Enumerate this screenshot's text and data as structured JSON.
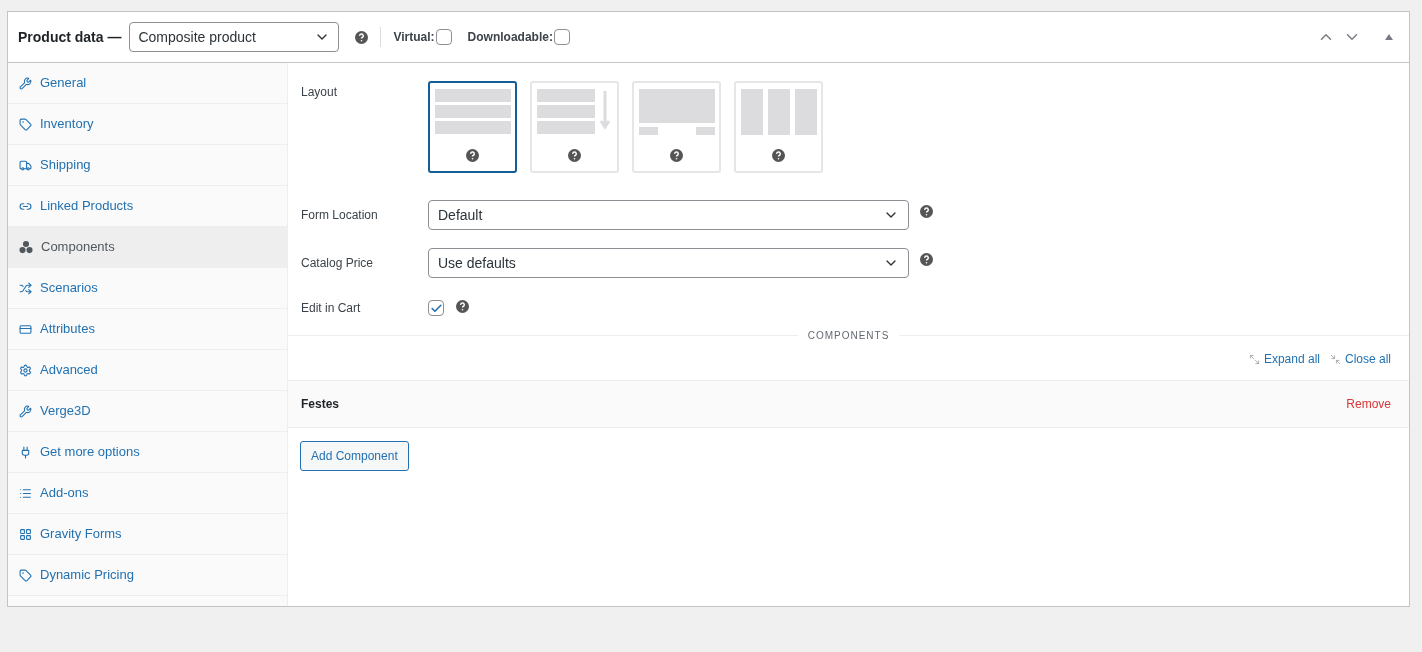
{
  "header": {
    "title": "Product data —",
    "product_type": "Composite product",
    "virtual": {
      "label": "Virtual:",
      "checked": false
    },
    "downloadable": {
      "label": "Downloadable:",
      "checked": false
    }
  },
  "sidebar": {
    "items": [
      {
        "label": "General",
        "selected": false
      },
      {
        "label": "Inventory",
        "selected": false
      },
      {
        "label": "Shipping",
        "selected": false
      },
      {
        "label": "Linked Products",
        "selected": false
      },
      {
        "label": "Components",
        "selected": true
      },
      {
        "label": "Scenarios",
        "selected": false
      },
      {
        "label": "Attributes",
        "selected": false
      },
      {
        "label": "Advanced",
        "selected": false
      },
      {
        "label": "Verge3D",
        "selected": false
      },
      {
        "label": "Get more options",
        "selected": false
      },
      {
        "label": "Add-ons",
        "selected": false
      },
      {
        "label": "Gravity Forms",
        "selected": false
      },
      {
        "label": "Dynamic Pricing",
        "selected": false
      }
    ]
  },
  "layout": {
    "label": "Layout",
    "options": [
      {
        "kind": "stacked",
        "selected": true
      },
      {
        "kind": "progressive",
        "selected": false
      },
      {
        "kind": "tabbed",
        "selected": false
      },
      {
        "kind": "columns",
        "selected": false
      }
    ]
  },
  "form_location": {
    "label": "Form Location",
    "value": "Default"
  },
  "catalog_price": {
    "label": "Catalog Price",
    "value": "Use defaults"
  },
  "edit_in_cart": {
    "label": "Edit in Cart",
    "checked": true
  },
  "components_heading": "COMPONENTS",
  "expand_all": "Expand all",
  "close_all": "Close all",
  "components": [
    {
      "name": "Festes",
      "remove": "Remove"
    }
  ],
  "add_component": "Add Component"
}
